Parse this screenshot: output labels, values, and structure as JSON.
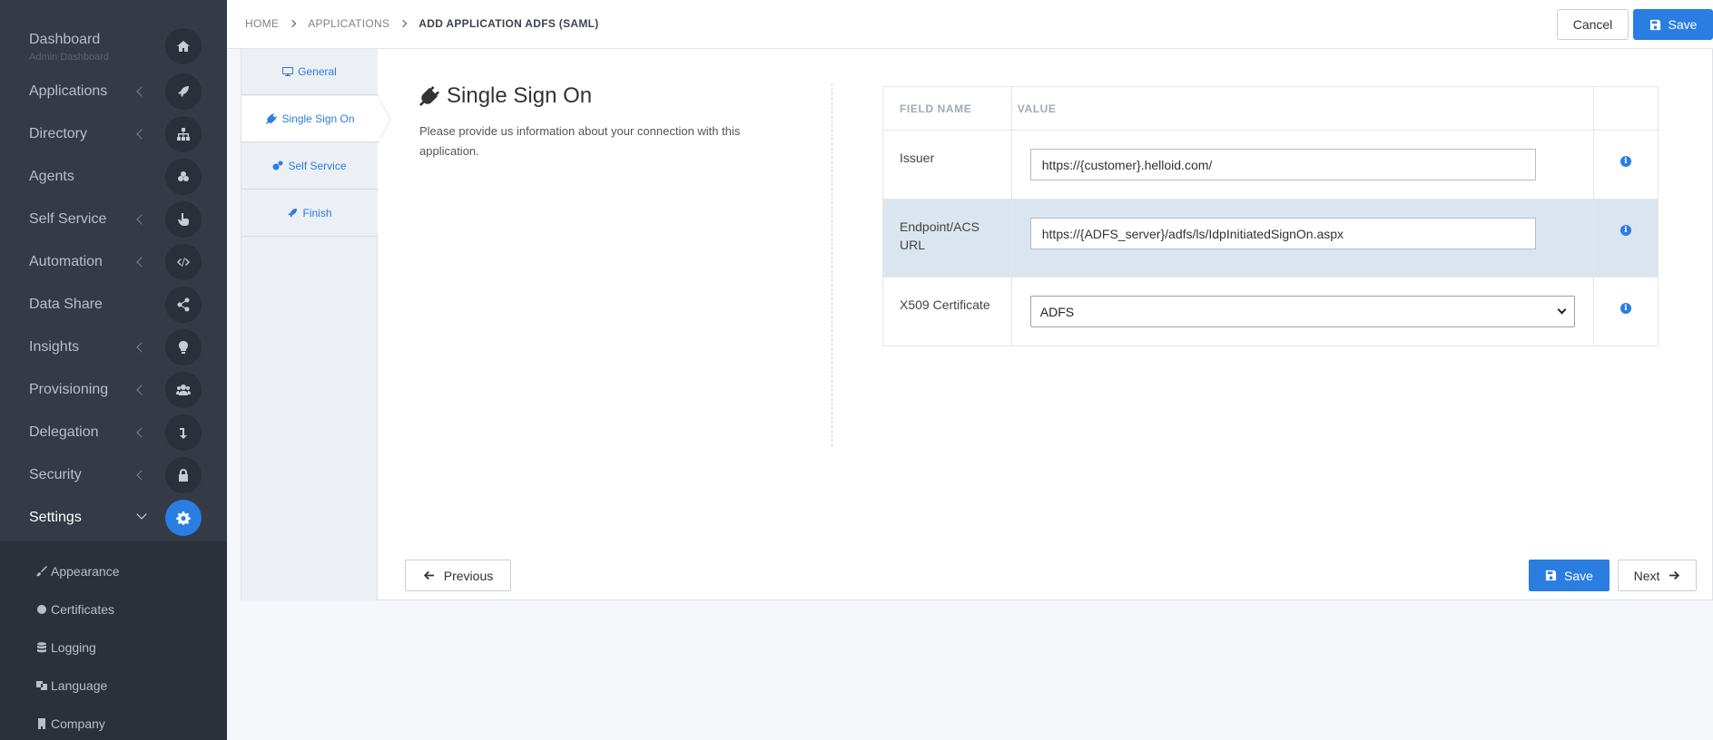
{
  "sidebar": {
    "items": [
      {
        "label": "Dashboard",
        "sub": "Admin Dashboard",
        "icon": "home-icon"
      },
      {
        "label": "Applications",
        "icon": "rocket-icon"
      },
      {
        "label": "Directory",
        "icon": "sitemap-icon"
      },
      {
        "label": "Agents",
        "icon": "network-icon"
      },
      {
        "label": "Self Service",
        "icon": "hand-pointer-icon"
      },
      {
        "label": "Automation",
        "icon": "code-icon"
      },
      {
        "label": "Data Share",
        "icon": "share-icon"
      },
      {
        "label": "Insights",
        "icon": "lightbulb-icon"
      },
      {
        "label": "Provisioning",
        "icon": "users-icon"
      },
      {
        "label": "Delegation",
        "icon": "level-down-icon"
      },
      {
        "label": "Security",
        "icon": "lock-icon"
      },
      {
        "label": "Settings",
        "icon": "gear-icon"
      }
    ],
    "submenu": [
      {
        "label": "Appearance",
        "icon": "paint-brush-icon"
      },
      {
        "label": "Certificates",
        "icon": "circle-icon"
      },
      {
        "label": "Logging",
        "icon": "database-icon"
      },
      {
        "label": "Language",
        "icon": "language-icon"
      },
      {
        "label": "Company",
        "icon": "building-icon"
      }
    ]
  },
  "header": {
    "breadcrumb": [
      "HOME",
      "APPLICATIONS",
      "ADD APPLICATION ADFS (SAML)"
    ],
    "cancel_label": "Cancel",
    "save_label": "Save"
  },
  "wizard": {
    "steps": [
      {
        "label": "General",
        "icon": "desktop-icon"
      },
      {
        "label": "Single Sign On",
        "icon": "plug-icon"
      },
      {
        "label": "Self Service",
        "icon": "cogs-icon"
      },
      {
        "label": "Finish",
        "icon": "rocket-icon"
      }
    ],
    "active_step": "Single Sign On"
  },
  "section": {
    "title": "Single Sign On",
    "description": "Please provide us information about your connection with this application."
  },
  "table": {
    "headers": [
      "FIELD NAME",
      "VALUE",
      ""
    ],
    "rows": [
      {
        "name": "Issuer",
        "value": "https://{customer}.helloid.com/",
        "type": "input"
      },
      {
        "name": "Endpoint/ACS URL",
        "value": "https://{ADFS_server}/adfs/ls/IdpInitiatedSignOn.aspx",
        "type": "input"
      },
      {
        "name": "X509 Certificate",
        "value": "ADFS",
        "type": "select"
      }
    ]
  },
  "footer": {
    "previous_label": "Previous",
    "save_label": "Save",
    "next_label": "Next"
  },
  "colors": {
    "accent": "#2a7de1",
    "sidebar_bg": "#343a46",
    "highlight_row": "#dbe5f0"
  }
}
